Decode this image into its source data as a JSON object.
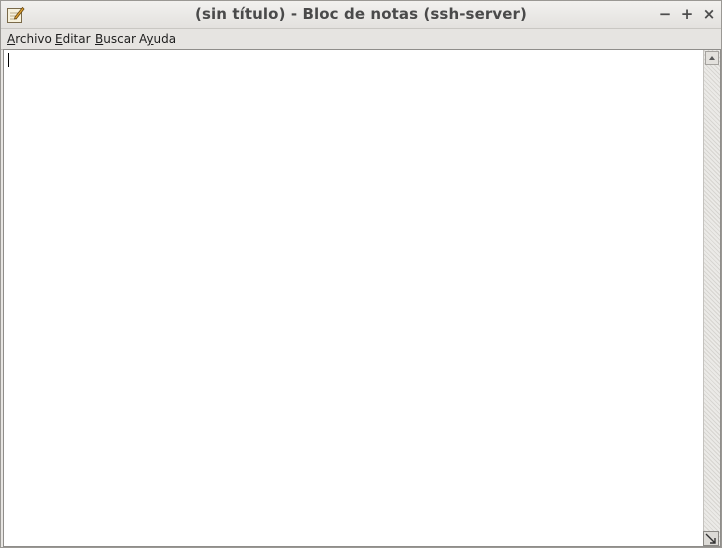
{
  "window": {
    "title": "(sin título) - Bloc de notas (ssh-server)",
    "icon": "notepad-icon",
    "buttons": {
      "minimize": "−",
      "maximize": "+",
      "close": "×"
    }
  },
  "menubar": {
    "items": [
      {
        "first": "A",
        "rest": "rchivo"
      },
      {
        "first": "E",
        "rest": "ditar"
      },
      {
        "first": "B",
        "rest": "uscar"
      },
      {
        "pre": "A",
        "first": "y",
        "rest": "uda"
      }
    ]
  },
  "editor": {
    "content": ""
  }
}
